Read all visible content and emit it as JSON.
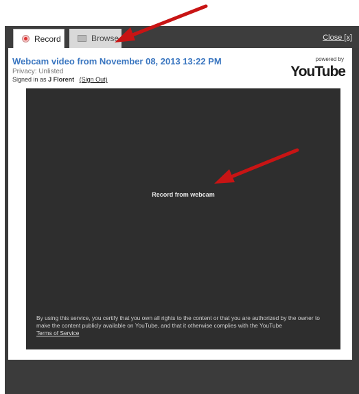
{
  "tabs": {
    "record_label": "Record",
    "browse_label": "Browse",
    "close_label": "Close [x]"
  },
  "video": {
    "title": "Webcam video from November 08, 2013 13:22 PM",
    "privacy": "Privacy: Unlisted",
    "signed_in_prefix": "Signed in as",
    "user": "J Florent",
    "sign_out": "(Sign Out)"
  },
  "branding": {
    "powered_by": "powered by",
    "logo": "YouTube"
  },
  "recorder": {
    "record_label": "Record from webcam",
    "disclaimer": "By using this service, you certify that you own all rights to the content or that you are authorized by the owner to make the content publicly available on YouTube, and that it otherwise complies with the YouTube",
    "tos_link": "Terms of Service"
  },
  "annotations": {
    "arrow_color": "#c81414"
  }
}
